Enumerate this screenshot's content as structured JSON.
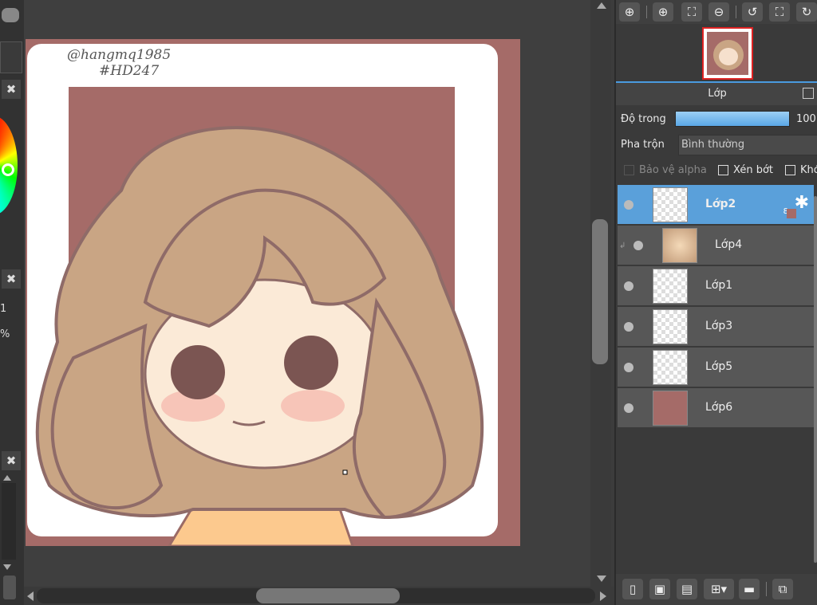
{
  "left_strip": {
    "close_labels": [
      "✖",
      "✖",
      "✖"
    ],
    "side_value": "1",
    "side_percent": "%"
  },
  "canvas": {
    "signature_line1": "@hangmq1985",
    "signature_line2": "#HD247"
  },
  "navigator": {
    "buttons": [
      {
        "name": "zoom-fit-icon",
        "glyph": "⊕"
      },
      {
        "name": "zoom-in-icon",
        "glyph": "⊕"
      },
      {
        "name": "fit-window-icon",
        "glyph": "⛶"
      },
      {
        "name": "zoom-out-icon",
        "glyph": "⊖"
      },
      {
        "name": "rotate-left-icon",
        "glyph": "↺"
      },
      {
        "name": "fullscreen-icon",
        "glyph": "⛶"
      },
      {
        "name": "rotate-right-icon",
        "glyph": "↻"
      }
    ]
  },
  "layer_panel": {
    "title": "Lớp",
    "opacity_label": "Độ trong",
    "opacity_value": "100",
    "blend_label": "Pha trộn",
    "blend_value": "Bình thường",
    "protect_alpha": "Bảo vệ alpha",
    "clipping": "Xén bớt",
    "lock": "Khó",
    "selected_badge": "8",
    "layers": [
      {
        "name": "Lớp2",
        "selected": true
      },
      {
        "name": "Lớp4",
        "selected": false
      },
      {
        "name": "Lớp1",
        "selected": false
      },
      {
        "name": "Lớp3",
        "selected": false
      },
      {
        "name": "Lớp5",
        "selected": false
      },
      {
        "name": "Lớp6",
        "selected": false
      }
    ]
  },
  "colors": {
    "accent": "#5aa0da",
    "art_background": "#a56b68",
    "hair": "#c9a584"
  }
}
